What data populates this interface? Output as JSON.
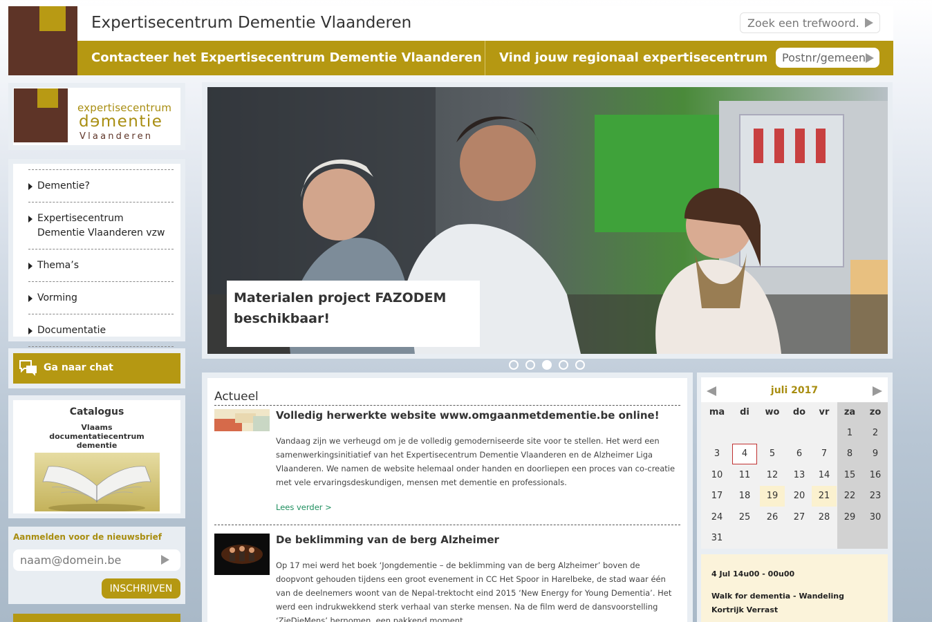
{
  "header": {
    "site_title": "Expertisecentrum Dementie Vlaanderen",
    "search_placeholder": "Zoek een trefwoord...",
    "contact_link": "Contacteer het Expertisecentrum Dementie Vlaanderen",
    "regional_link": "Vind jouw regionaal expertisecentrum",
    "postnr_placeholder": "Postnr/gemeente"
  },
  "logo": {
    "line1": "expertisecentrum",
    "line2": "dɘmentie",
    "line3": "Vlaanderen",
    "brown": "#5e3427",
    "gold": "#b59812"
  },
  "nav": {
    "items": [
      {
        "label": "Dementie?"
      },
      {
        "label": "Expertisecentrum Dementie Vlaanderen vzw"
      },
      {
        "label": "Thema’s"
      },
      {
        "label": "Vorming"
      },
      {
        "label": "Documentatie"
      }
    ]
  },
  "chat": {
    "label": "Ga naar chat",
    "icon": "chat-bubbles-icon"
  },
  "catalogus": {
    "title": "Catalogus",
    "subtitle_1": "Vlaams",
    "subtitle_2": "documentatiecentrum",
    "subtitle_3": "dementie"
  },
  "newsletter": {
    "title": "Aanmelden voor de nieuwsbrief",
    "placeholder": "naam@domein.be",
    "button": "INSCHRIJVEN"
  },
  "slider": {
    "caption": "Materialen project FAZODEM beschikbaar!",
    "slide_count": 5,
    "active_index": 2
  },
  "actueel": {
    "heading": "Actueel",
    "articles": [
      {
        "title": "Volledig herwerkte website www.omgaanmetdementie.be online!",
        "body": "Vandaag zijn we verheugd om je de volledig gemoderniseerde site voor te stellen. Het werd een samenwerkingsinitiatief van het Expertisecentrum Dementie Vlaanderen en de Alzheimer Liga Vlaanderen. We namen de website helemaal onder handen en doorliepen een proces van co-creatie met vele ervaringsdeskundigen, mensen met dementie en professionals.",
        "more": "Lees verder >"
      },
      {
        "title": "De beklimming van de berg Alzheimer",
        "body": "Op 17 mei werd het boek ‘Jongdementie – de beklimming van de berg Alzheimer’ boven de doopvont gehouden tijdens een groot evenement in CC Het Spoor in Harelbeke, de stad waar één van de deelnemers woont van de Nepal-trektocht eind 2015 ‘New Energy for Young Dementia’. Het werd een indrukwekkend sterk verhaal van sterke mensen. Na de film werd de dansvoorstelling ‘ZieDieMens’ hernomen, een pakkend moment."
      }
    ]
  },
  "calendar": {
    "month": "juli 2017",
    "weekdays": [
      "ma",
      "di",
      "wo",
      "do",
      "vr",
      "za",
      "zo"
    ],
    "first_weekday_index": 5,
    "days_in_month": 31,
    "today": 4,
    "event_days": [
      19,
      21
    ],
    "event": {
      "date": "4 Jul 14u00 - 00u00",
      "title": "Walk for dementia - Wandeling Kortrijk Verrast"
    }
  }
}
